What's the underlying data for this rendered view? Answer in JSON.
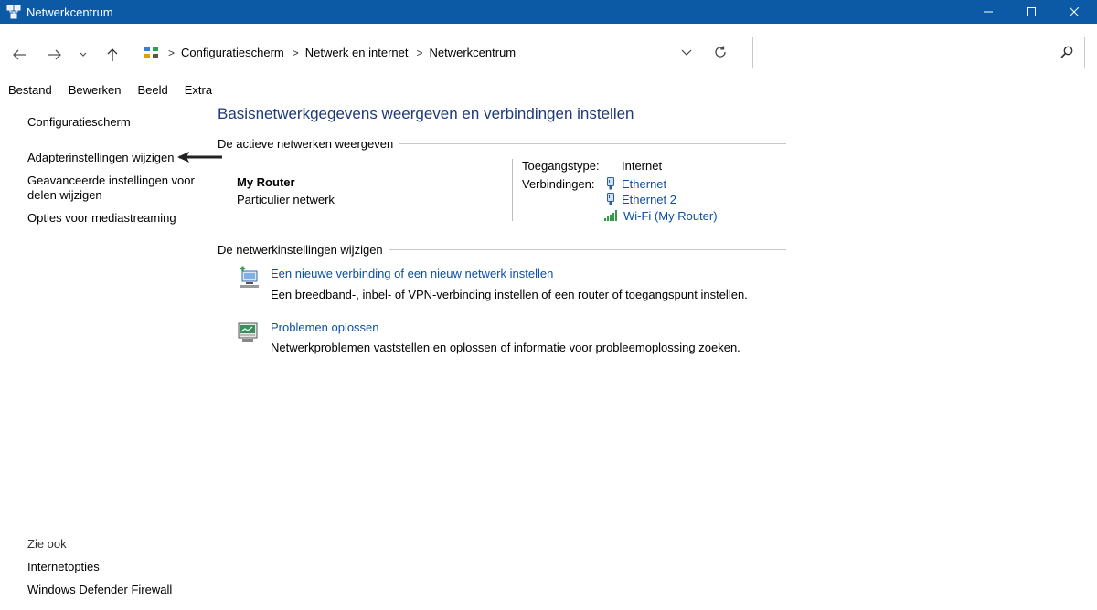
{
  "window": {
    "title": "Netwerkcentrum"
  },
  "address_bar": {
    "breadcrumbs": [
      "Configuratiescherm",
      "Netwerk en internet",
      "Netwerkcentrum"
    ]
  },
  "search": {
    "value": "",
    "placeholder": ""
  },
  "menu": [
    "Bestand",
    "Bewerken",
    "Beeld",
    "Extra"
  ],
  "left_pane": {
    "links": [
      "Configuratiescherm",
      "Adapterinstellingen wijzigen",
      "Geavanceerde instellingen voor",
      "delen wijzigen",
      "Opties voor mediastreaming"
    ],
    "see_also_label": "Zie ook",
    "see_also": [
      "Internetopties",
      "Windows Defender Firewall"
    ]
  },
  "main": {
    "title": "Basisnetwerkgegevens weergeven en verbindingen instellen",
    "active_networks_header": "De actieve netwerken weergeven",
    "network": {
      "name": "My Router",
      "type": "Particulier netwerk",
      "access_type_label": "Toegangstype:",
      "access_type_value": "Internet",
      "connections_label": "Verbindingen:",
      "connections": [
        "Ethernet",
        "Ethernet 2",
        "Wi-Fi (My Router)"
      ]
    },
    "change_settings_header": "De netwerkinstellingen wijzigen",
    "actions": [
      {
        "link": "Een nieuwe verbinding of een nieuw netwerk instellen",
        "description": "Een breedband-, inbel- of VPN-verbinding instellen of een router of toegangspunt instellen."
      },
      {
        "link": "Problemen oplossen",
        "description": "Netwerkproblemen vaststellen en oplossen of informatie voor probleemoplossing zoeken."
      }
    ]
  },
  "icons": {
    "app": "network-center-icon",
    "ethernet": "ethernet-icon",
    "wifi": "wifi-signal-icon"
  },
  "colors": {
    "titlebar": "#0c5aa6",
    "link": "#0b4fa3",
    "title_text": "#1e3a78"
  }
}
